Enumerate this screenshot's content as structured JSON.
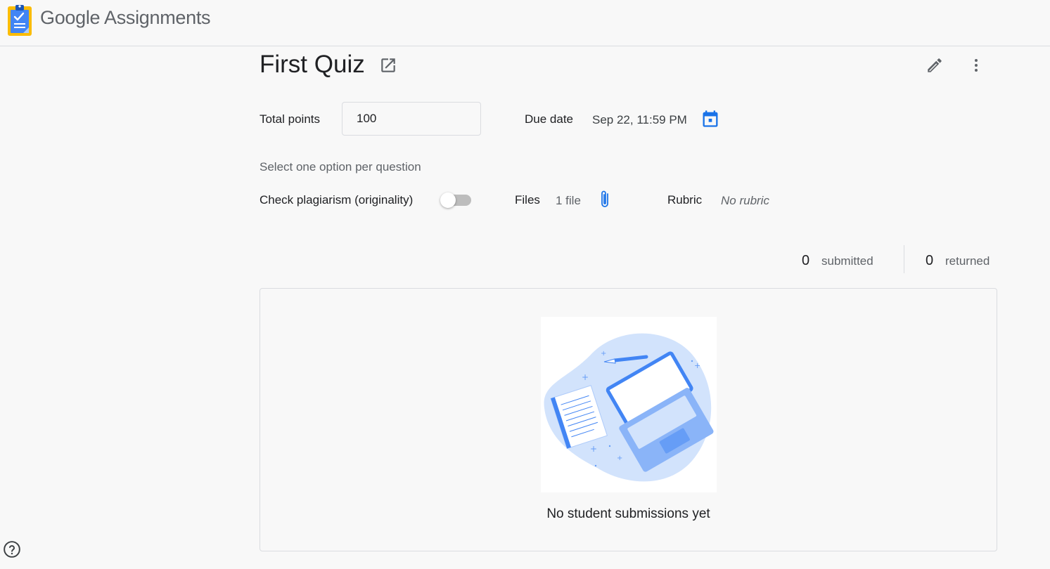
{
  "app": {
    "brand": "Google",
    "product": "Assignments"
  },
  "assignment": {
    "title": "First Quiz",
    "total_points_label": "Total points",
    "total_points_value": "100",
    "due_date_label": "Due date",
    "due_date_value": "Sep 22, 11:59 PM",
    "instructions": "Select one option per question",
    "plagiarism_label": "Check plagiarism (originality)",
    "plagiarism_enabled": false,
    "files_label": "Files",
    "files_value": "1 file",
    "rubric_label": "Rubric",
    "rubric_value": "No rubric"
  },
  "stats": {
    "submitted_count": "0",
    "submitted_label": "submitted",
    "returned_count": "0",
    "returned_label": "returned"
  },
  "empty_state": {
    "message": "No student submissions yet"
  },
  "icons": {
    "logo": "assignments-clipboard-icon",
    "open": "open-in-new-icon",
    "edit": "pencil-icon",
    "more": "more-vert-icon",
    "calendar": "calendar-icon",
    "attach": "paperclip-icon",
    "help": "help-circle-icon"
  },
  "colors": {
    "accent": "#1a73e8",
    "text": "#202124",
    "muted": "#5f6368"
  }
}
